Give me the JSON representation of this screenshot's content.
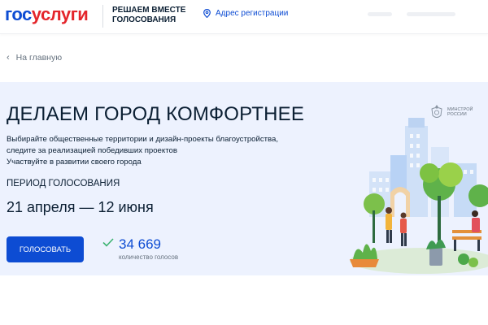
{
  "header": {
    "logo_part1": "гос",
    "logo_part2": "услуги",
    "project_line1": "РЕШАЕМ ВМЕСТЕ",
    "project_line2": "ГОЛОСОВАНИЯ",
    "region_label": "Адрес регистрации",
    "accent": "#0d4cd3",
    "logo_red": "#e4252b"
  },
  "nav": {
    "back_label": "На главную"
  },
  "hero": {
    "title": "ДЕЛАЕМ ГОРОД КОМФОРТНЕЕ",
    "description": [
      "Выбирайте общественные территории и дизайн-проекты благоустройства,",
      "следите за реализацией победивших проектов",
      "Участвуйте в развитии своего города"
    ],
    "period_label": "ПЕРИОД ГОЛОСОВАНИЯ",
    "period_value": "21 апреля — 12 июня",
    "vote_button": "ГОЛОСОВАТЬ",
    "votes_count": "34 669",
    "votes_label": "количество голосов",
    "ministry_line1": "МИНСТРОЙ",
    "ministry_line2": "РОССИИ",
    "background": "#edf2fe"
  }
}
